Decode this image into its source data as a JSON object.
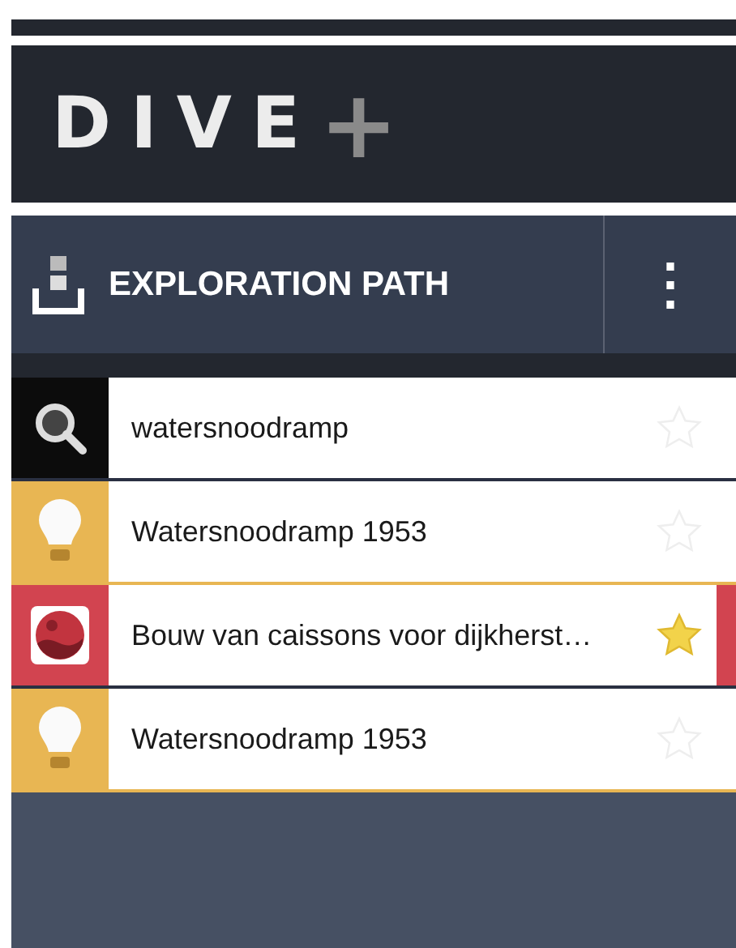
{
  "logo": {
    "text": "DIVE",
    "mark": "+"
  },
  "header": {
    "title": "EXPLORATION PATH",
    "menu": "⋮"
  },
  "path": [
    {
      "kind": "search",
      "label": "watersnoodramp",
      "starred": false,
      "selected": false
    },
    {
      "kind": "concept",
      "label": "Watersnoodramp 1953",
      "starred": false,
      "selected": false
    },
    {
      "kind": "media",
      "label": "Bouw van caissons voor dijkherst…",
      "starred": true,
      "selected": true
    },
    {
      "kind": "concept",
      "label": "Watersnoodramp 1953",
      "starred": false,
      "selected": false
    }
  ]
}
